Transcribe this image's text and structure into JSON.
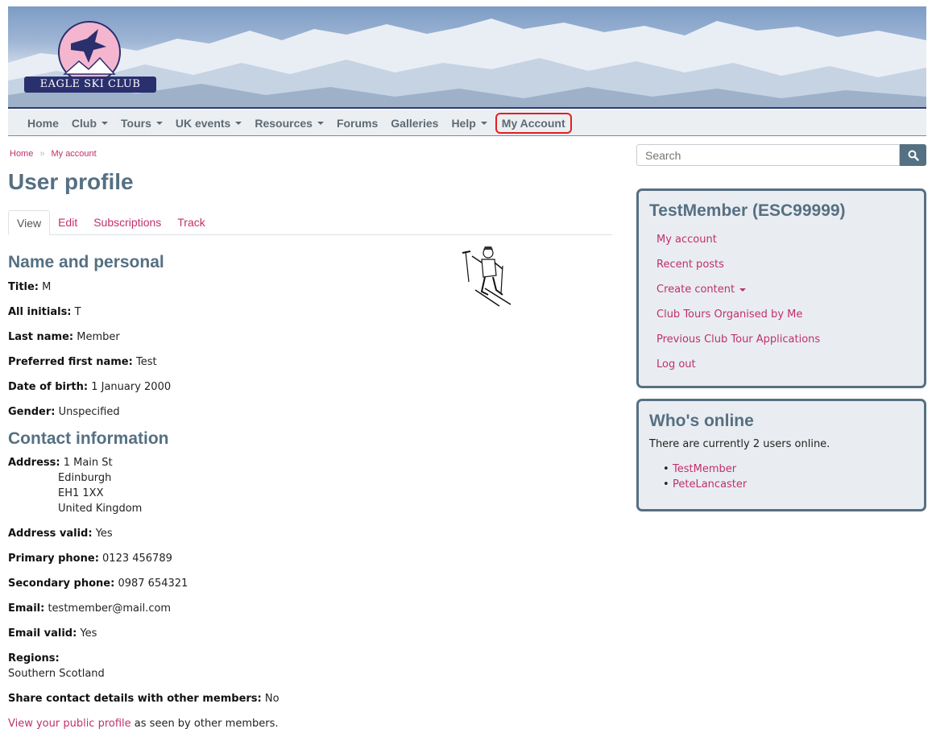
{
  "logo": {
    "text": "EAGLE SKI CLUB"
  },
  "nav": {
    "items": [
      {
        "label": "Home",
        "has_caret": false
      },
      {
        "label": "Club",
        "has_caret": true
      },
      {
        "label": "Tours",
        "has_caret": true
      },
      {
        "label": "UK events",
        "has_caret": true
      },
      {
        "label": "Resources",
        "has_caret": true
      },
      {
        "label": "Forums",
        "has_caret": false
      },
      {
        "label": "Galleries",
        "has_caret": false
      },
      {
        "label": "Help",
        "has_caret": true
      },
      {
        "label": "My Account",
        "has_caret": false,
        "highlighted": true
      }
    ]
  },
  "breadcrumb": {
    "home": "Home",
    "sep": "»",
    "current": "My account"
  },
  "page_title": "User profile",
  "tabs": [
    {
      "label": "View",
      "active": true
    },
    {
      "label": "Edit"
    },
    {
      "label": "Subscriptions"
    },
    {
      "label": "Track"
    }
  ],
  "sections": {
    "personal_title": "Name and personal",
    "contact_title": "Contact information"
  },
  "personal": {
    "title_label": "Title:",
    "title_value": "M",
    "initials_label": "All initials:",
    "initials_value": "T",
    "last_name_label": "Last name:",
    "last_name_value": "Member",
    "preferred_label": "Preferred first name:",
    "preferred_value": "Test",
    "dob_label": "Date of birth:",
    "dob_value": "1 January 2000",
    "gender_label": "Gender:",
    "gender_value": "Unspecified"
  },
  "contact": {
    "address_label": "Address:",
    "address_lines": [
      "1 Main St",
      "Edinburgh",
      "EH1 1XX",
      "United Kingdom"
    ],
    "address_valid_label": "Address valid:",
    "address_valid_value": "Yes",
    "primary_phone_label": "Primary phone:",
    "primary_phone_value": "0123 456789",
    "secondary_phone_label": "Secondary phone:",
    "secondary_phone_value": "0987 654321",
    "email_label": "Email:",
    "email_value": "testmember@mail.com",
    "email_valid_label": "Email valid:",
    "email_valid_value": "Yes",
    "regions_label": "Regions:",
    "regions_value": "Southern Scotland",
    "share_label": "Share contact details with other members:",
    "share_value": "No"
  },
  "public_profile": {
    "link": "View your public profile",
    "rest": "as seen by other members."
  },
  "search": {
    "placeholder": "Search"
  },
  "user_block": {
    "title": "TestMember (ESC99999)",
    "links": [
      "My account",
      "Recent posts",
      "Create content",
      "Club Tours Organised by Me",
      "Previous Club Tour Applications",
      "Log out"
    ]
  },
  "online_block": {
    "title": "Who's online",
    "text": "There are currently 2 users online.",
    "users": [
      "TestMember",
      "PeteLancaster"
    ]
  },
  "colors": {
    "accent": "#557082",
    "link": "#c0306a",
    "nav_bg": "#eceff2",
    "highlight": "#e02020"
  }
}
